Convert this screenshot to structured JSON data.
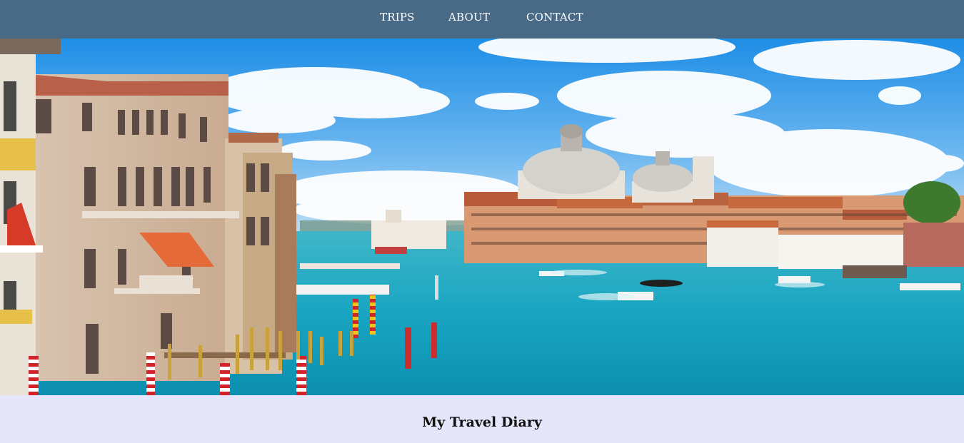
{
  "nav": {
    "links": [
      {
        "label": "TRIPS"
      },
      {
        "label": "ABOUT"
      },
      {
        "label": "CONTACT"
      }
    ]
  },
  "hero": {
    "image_description": "venice-grand-canal-image"
  },
  "main": {
    "heading": "My Travel Diary"
  },
  "colors": {
    "navbar": "#486a87",
    "page_background": "#e6e6fa",
    "nav_text": "#ffffff",
    "heading_text": "#111111"
  }
}
